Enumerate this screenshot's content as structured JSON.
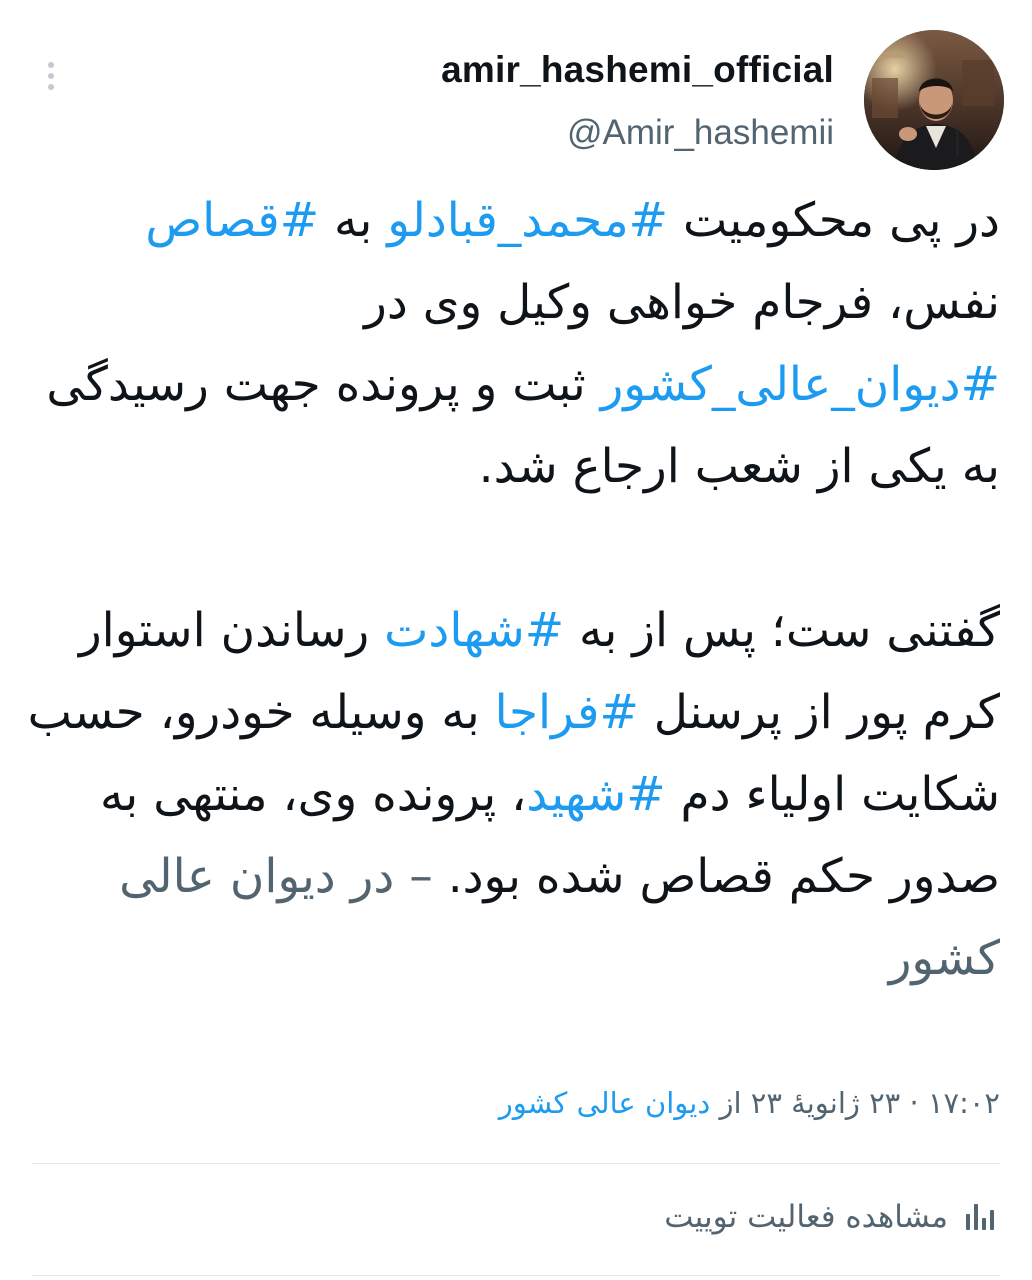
{
  "author": {
    "display_name": "amir_hashemi_official",
    "handle": "@Amir_hashemii"
  },
  "tweet": {
    "paragraph1": [
      {
        "text": "در پی محکومیت ",
        "hashtag": false
      },
      {
        "text": "#محمد_قبادلو",
        "hashtag": true
      },
      {
        "text": " به ",
        "hashtag": false
      },
      {
        "text": "#قصاص",
        "hashtag": true
      },
      {
        "text": " نفس، فرجام خواهی وکیل وی در ",
        "hashtag": false
      },
      {
        "text": "#دیوان_عالی_کشور",
        "hashtag": true
      },
      {
        "text": " ثبت و پرونده جهت رسیدگی به یکی از شعب ارجاع شد.",
        "hashtag": false
      }
    ],
    "paragraph2": [
      {
        "text": "گفتنی ست؛ پس از به ",
        "hashtag": false
      },
      {
        "text": "#شهادت",
        "hashtag": true
      },
      {
        "text": " رساندن استوار کرم پور از پرسنل ",
        "hashtag": false
      },
      {
        "text": "#فراجا",
        "hashtag": true
      },
      {
        "text": " به وسیله خودرو، حسب شکایت اولیاء دم ",
        "hashtag": false
      },
      {
        "text": "#شهید",
        "hashtag": true
      },
      {
        "text": "، پرونده وی، منتهی به صدور حکم قصاص شده بود. ",
        "hashtag": false
      }
    ],
    "quoted_source": "– در دیوان عالی کشور"
  },
  "meta": {
    "time": "۱۷:۰۲",
    "separator": "·",
    "date": "۲۳ ژانویهٔ ۲۳",
    "from_label": "از",
    "source": "دیوان عالی کشور"
  },
  "actions": {
    "view_activity_label": "مشاهده فعالیت توییت"
  },
  "colors": {
    "link": "#1d9bf0",
    "text": "#0f1419",
    "secondary": "#536471",
    "divider": "#e7e9ea"
  },
  "icons": {
    "more": "vertical-ellipsis-icon",
    "activity": "bar-chart-icon"
  }
}
